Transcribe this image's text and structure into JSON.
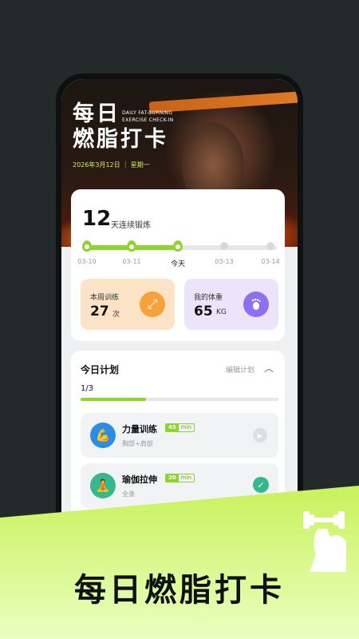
{
  "hero": {
    "title_line1": "每日",
    "title_line2": "燃脂打卡",
    "subtitle_en_line1": "DAILY FAT-BURNING",
    "subtitle_en_line2": "EXERCISE CHECK-IN",
    "date": "2026年3月12日 ｜ 星期一"
  },
  "streak": {
    "count": "12",
    "label": "天连续锻炼",
    "days": [
      {
        "label": "03-10",
        "done": true
      },
      {
        "label": "03-11",
        "done": true
      },
      {
        "label": "今天",
        "done": true
      },
      {
        "label": "03-13",
        "done": false
      },
      {
        "label": "03-14",
        "done": false
      }
    ]
  },
  "stats": {
    "weekly": {
      "label": "本周训练",
      "value": "27",
      "unit": "次",
      "icon": "arrows-expand-icon"
    },
    "weight": {
      "label": "我的体重",
      "value": "65",
      "unit": "KG",
      "icon": "footprint-icon"
    }
  },
  "plan": {
    "title": "今日计划",
    "edit_label": "编辑计划",
    "progress": "1/3",
    "progress_fraction": 0.33,
    "items": [
      {
        "name": "力量训练",
        "minutes": "45",
        "unit": "min",
        "sub": "胸部+肩部",
        "status": "pending",
        "icon": "bicep-icon"
      },
      {
        "name": "瑜伽拉伸",
        "minutes": "20",
        "unit": "min",
        "sub": "全身",
        "status": "done",
        "icon": "yoga-icon"
      },
      {
        "name": "",
        "minutes": "",
        "unit": "",
        "sub": "",
        "status": "",
        "icon": "run-icon"
      }
    ]
  },
  "banner": {
    "text": "每日燃脂打卡"
  },
  "colors": {
    "accent": "#8fd42e",
    "banner": "#c8f25c",
    "background": "#24292a"
  }
}
